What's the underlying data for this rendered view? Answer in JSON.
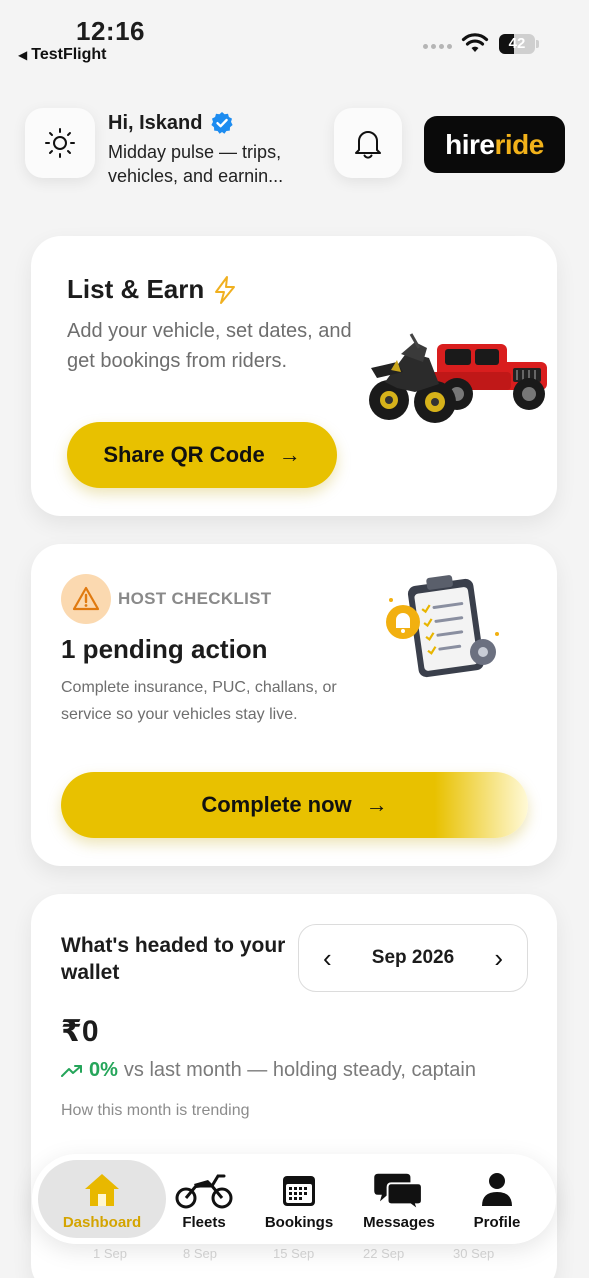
{
  "status_bar": {
    "time": "12:16",
    "back_app": "TestFlight",
    "battery": "42",
    "battery_level": 0.42
  },
  "header": {
    "greeting": "Hi, Iskand",
    "subtitle": "Midday pulse — trips, vehicles, and earnin...",
    "logo_part1": "hire",
    "logo_part2": "ride"
  },
  "earn_card": {
    "title": "List & Earn",
    "description": "Add your vehicle, set dates, and get bookings from riders.",
    "button_label": "Share QR Code"
  },
  "checklist_card": {
    "label": "HOST CHECKLIST",
    "title": "1 pending action",
    "description": "Complete insurance, PUC, challans, or service so your vehicles stay live.",
    "button_label": "Complete now"
  },
  "wallet_card": {
    "title": "What's headed to your wallet",
    "month": "Sep 2026",
    "amount": "₹0",
    "trend_percent": "0%",
    "trend_text": "vs last month — holding steady, captain",
    "trend_sub": "How this month is trending",
    "x_ticks": [
      "1 Sep",
      "8 Sep",
      "15 Sep",
      "22 Sep",
      "30 Sep"
    ]
  },
  "tab_bar": {
    "tabs": [
      {
        "label": "Dashboard",
        "icon": "home-icon",
        "active": true
      },
      {
        "label": "Fleets",
        "icon": "motorcycle-icon",
        "active": false
      },
      {
        "label": "Bookings",
        "icon": "calendar-icon",
        "active": false
      },
      {
        "label": "Messages",
        "icon": "chat-bubbles-icon",
        "active": false
      },
      {
        "label": "Profile",
        "icon": "person-icon",
        "active": false
      }
    ]
  },
  "colors": {
    "accent_yellow": "#e8c100",
    "trend_green": "#25a55a",
    "active_tab_label": "#d4a400",
    "verified_blue": "#1d8cf0"
  }
}
